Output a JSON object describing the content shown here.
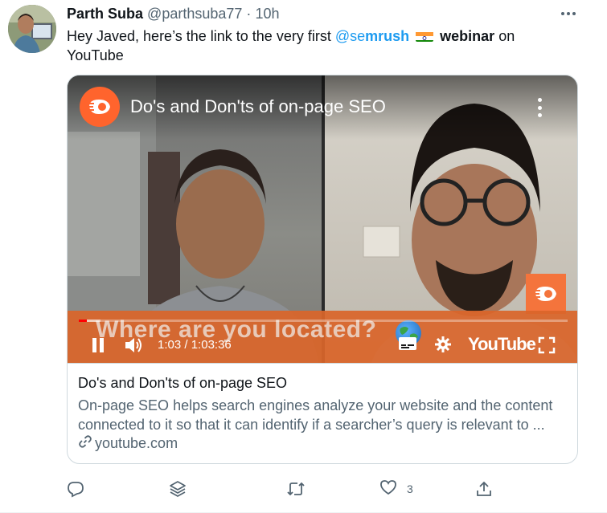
{
  "tweet": {
    "author_name": "Parth Suba",
    "author_handle": "@parthsuba77",
    "separator": "·",
    "time": "10h",
    "text_part1": "Hey Javed, here’s the link to the very first ",
    "mention_prefix": "@se",
    "mention_bold": "mrush",
    "text_bold": "webinar",
    "text_part2": " on",
    "text_line2": "YouTube",
    "like_count": "3"
  },
  "card": {
    "video": {
      "title": "Do's and Don'ts of on-page SEO",
      "overlay_text": "Where are you located?",
      "time_current": "1:03",
      "time_separator": " / ",
      "time_total": "1:03:36",
      "logo_text": "YouTube",
      "progress_fraction": 0.017,
      "loaded_fraction": 0.045
    },
    "title": "Do's and Don'ts of on-page SEO",
    "description": "On-page SEO helps search engines analyze your website and the content connected to it so that it can identify if a searcher’s query is relevant to ...",
    "domain": "youtube.com"
  },
  "colors": {
    "accent": "#1d9bf0",
    "brand_orange": "#ff642d",
    "progress_red": "#ff0000",
    "secondary_text": "#536471"
  },
  "icons": {
    "reply": "reply-icon",
    "stack": "stack-icon",
    "retweet": "retweet-icon",
    "like": "heart-icon",
    "share": "share-icon",
    "link": "link-icon"
  }
}
